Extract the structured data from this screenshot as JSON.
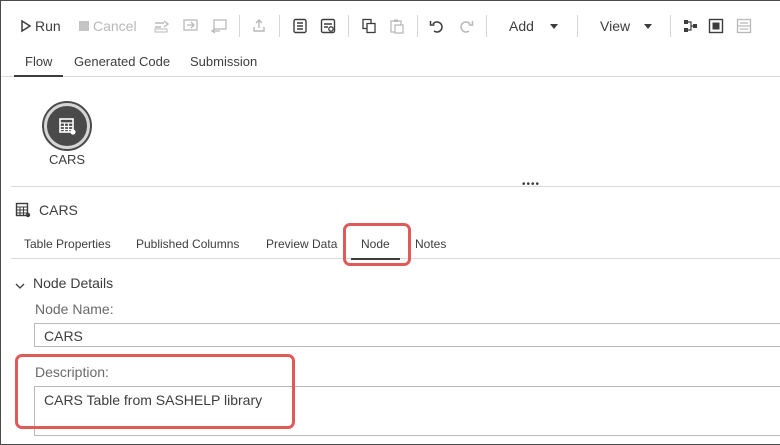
{
  "toolbar": {
    "run_label": "Run",
    "cancel_label": "Cancel",
    "add_label": "Add",
    "view_label": "View"
  },
  "top_tabs": [
    {
      "label": "Flow",
      "active": true
    },
    {
      "label": "Generated Code",
      "active": false
    },
    {
      "label": "Submission",
      "active": false
    }
  ],
  "canvas": {
    "node": {
      "label": "CARS",
      "icon": "table-icon"
    }
  },
  "details": {
    "title": "CARS",
    "tabs": [
      {
        "label": "Table Properties",
        "active": false
      },
      {
        "label": "Published Columns",
        "active": false
      },
      {
        "label": "Preview Data",
        "active": false
      },
      {
        "label": "Node",
        "active": true
      },
      {
        "label": "Notes",
        "active": false
      }
    ],
    "section_title": "Node Details",
    "node_name_label": "Node Name:",
    "node_name_value": "CARS",
    "description_label": "Description:",
    "description_value": "CARS Table from SASHELP library"
  },
  "colors": {
    "highlight": "#e05a5a",
    "node_fill": "#4a4a4a",
    "text": "#3d3d3d"
  }
}
